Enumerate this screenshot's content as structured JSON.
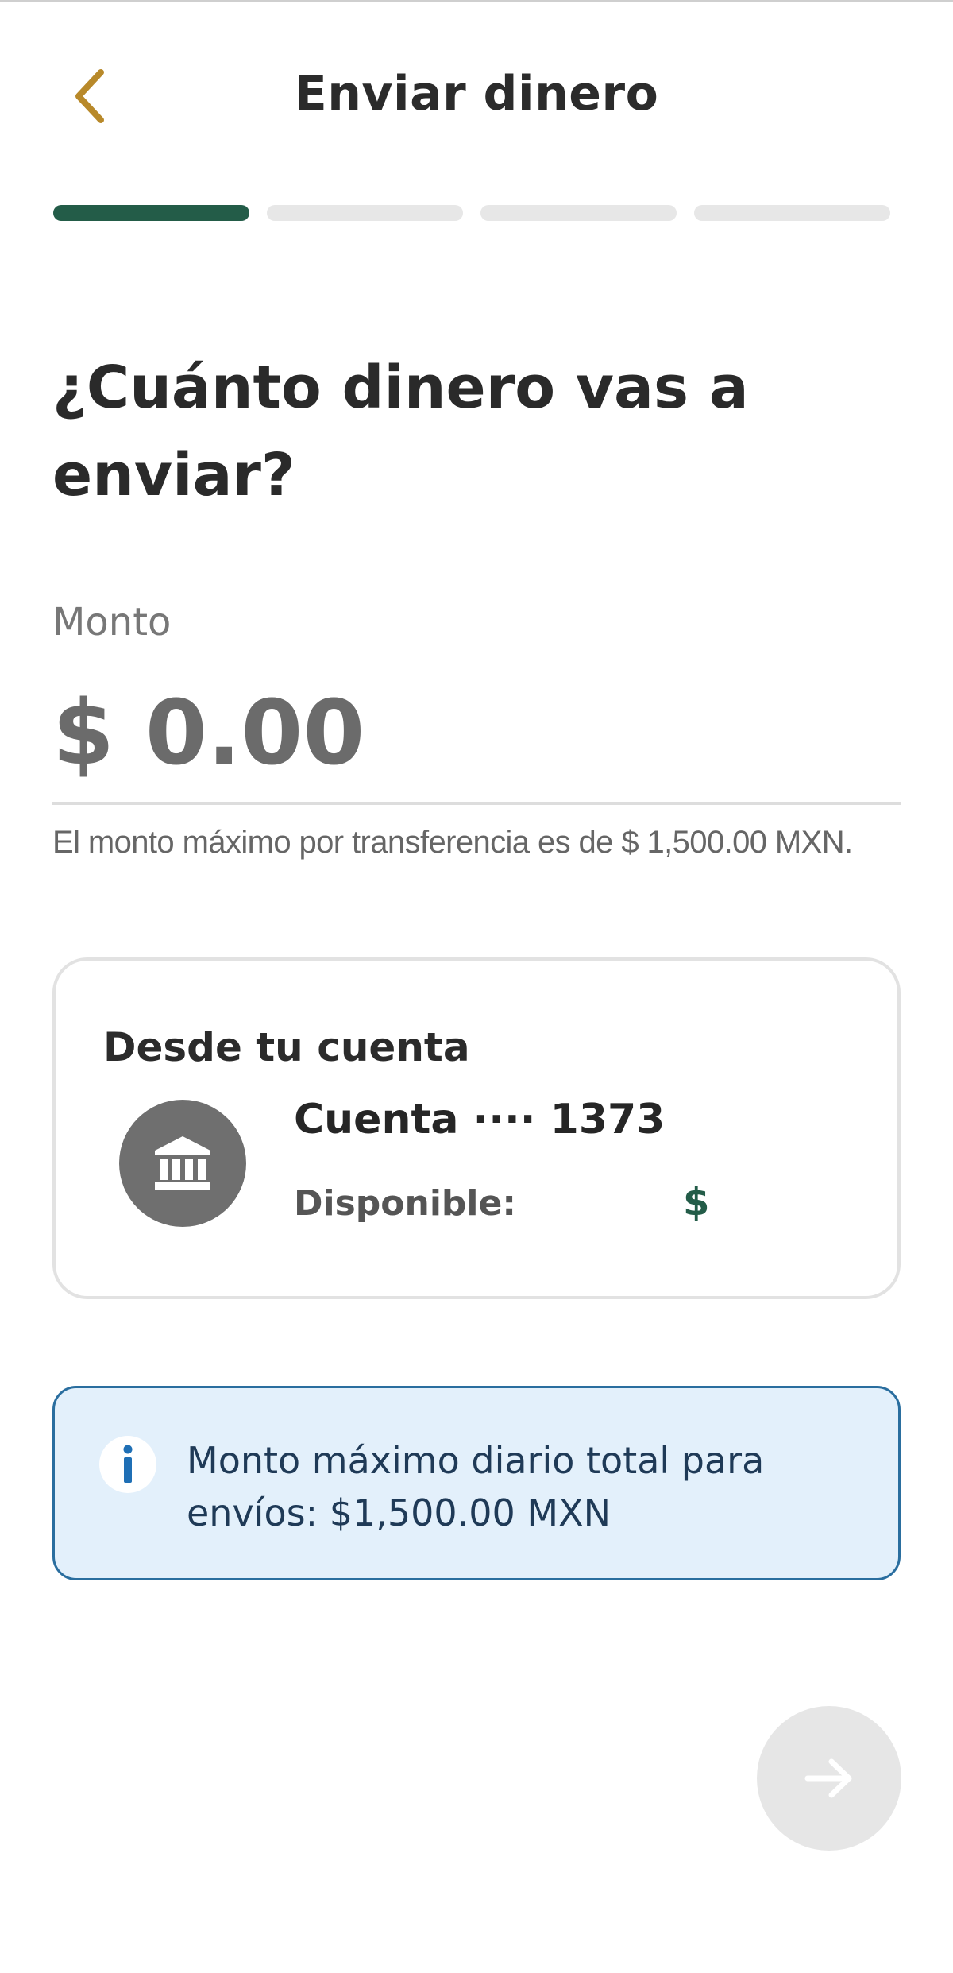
{
  "header": {
    "title": "Enviar dinero",
    "back_icon": "chevron-left-icon",
    "back_icon_color": "#b8892a"
  },
  "progress": {
    "total_steps": 4,
    "current_step": 1,
    "active_color": "#235c48"
  },
  "question": "¿Cuánto dinero vas a enviar?",
  "amount": {
    "label": "Monto",
    "value": "$ 0.00",
    "max_note": "El monto máximo por transferencia es de $ 1,500.00 MXN."
  },
  "account_card": {
    "title": "Desde tu cuenta",
    "icon": "bank-icon",
    "account_name": "Cuenta ···· 1373",
    "available_label": "Disponible:",
    "available_value": "$"
  },
  "info_banner": {
    "icon": "info-icon",
    "text": "Monto máximo diario total para envíos: $1,500.00 MXN"
  },
  "next_button": {
    "icon": "arrow-right-icon",
    "enabled": false
  }
}
